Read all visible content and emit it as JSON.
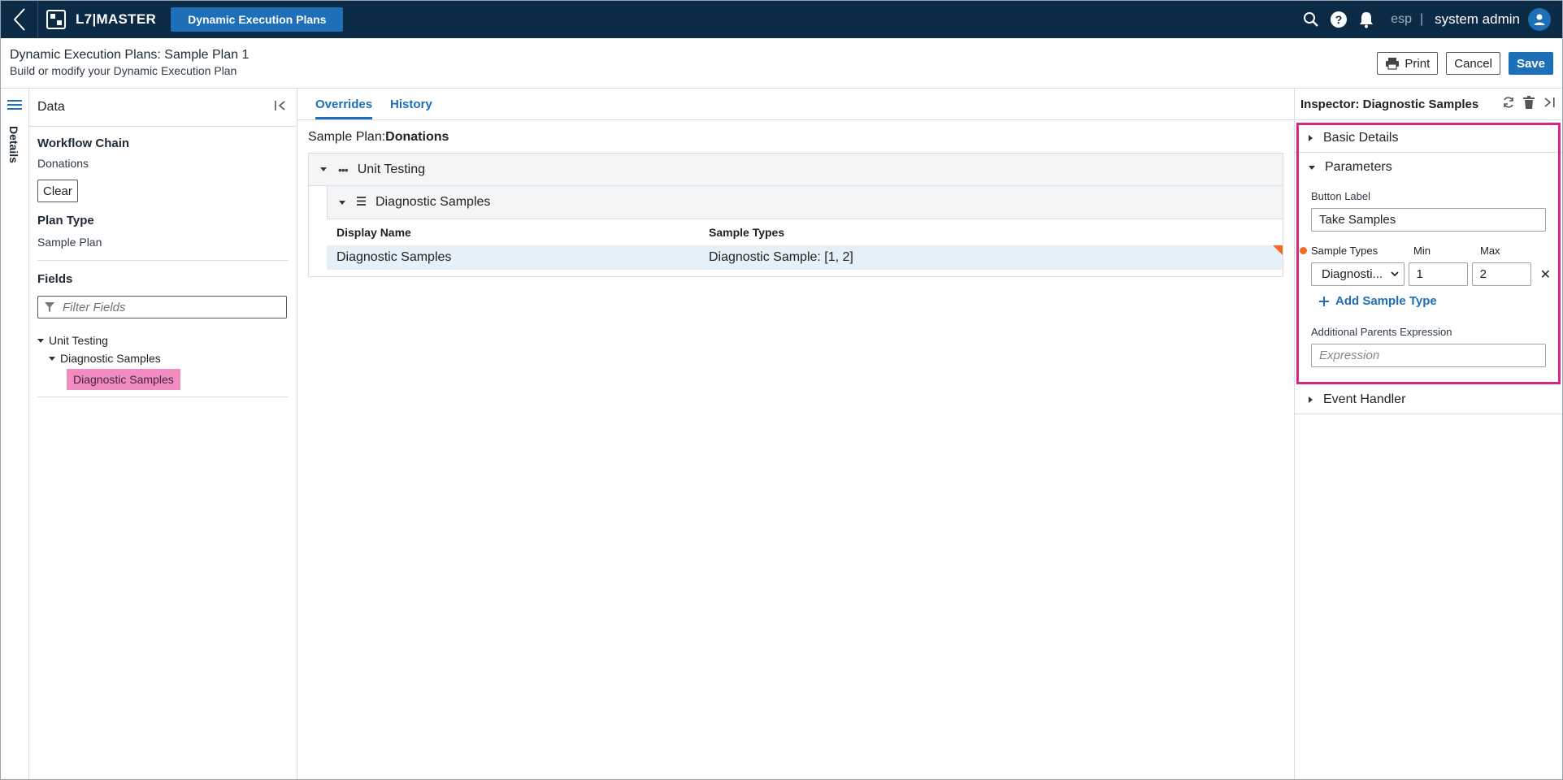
{
  "topbar": {
    "logo_text": "L7|MASTER",
    "app_name": "Dynamic Execution Plans",
    "lang": "esp",
    "separator": "|",
    "user": "system admin"
  },
  "page": {
    "title": "Dynamic Execution Plans: Sample Plan 1",
    "subtitle": "Build or modify your Dynamic Execution Plan",
    "print_label": "Print",
    "cancel_label": "Cancel",
    "save_label": "Save"
  },
  "rail": {
    "label": "Details"
  },
  "data_panel": {
    "title": "Data",
    "workflow_chain_label": "Workflow Chain",
    "workflow_chain_value": "Donations",
    "clear_label": "Clear",
    "plan_type_label": "Plan Type",
    "plan_type_value": "Sample Plan",
    "fields_label": "Fields",
    "filter_placeholder": "Filter Fields",
    "tree": {
      "root": "Unit Testing",
      "child": "Diagnostic Samples",
      "leaf": "Diagnostic Samples"
    }
  },
  "center": {
    "tabs": [
      "Overrides",
      "History"
    ],
    "plan_prefix": "Sample Plan:",
    "plan_name": "Donations",
    "group_unit": "Unit Testing",
    "group_diag": "Diagnostic Samples",
    "columns": [
      "Display Name",
      "Sample Types"
    ],
    "rows": [
      {
        "display_name": "Diagnostic Samples",
        "sample_types": "Diagnostic Sample: [1, 2]"
      }
    ]
  },
  "inspector": {
    "title": "Inspector: Diagnostic Samples",
    "basic_details": "Basic Details",
    "parameters": "Parameters",
    "button_label_label": "Button Label",
    "button_label_value": "Take Samples",
    "sample_types_label": "Sample Types",
    "min_label": "Min",
    "max_label": "Max",
    "sample_type_value": "Diagnosti...",
    "min_value": "1",
    "max_value": "2",
    "add_sample_type": "Add Sample Type",
    "additional_parents_label": "Additional Parents Expression",
    "expression_placeholder": "Expression",
    "event_handler": "Event Handler",
    "close_symbol": "✕"
  },
  "colors": {
    "topbar_bg": "#0b2a45",
    "accent": "#1d6fb8",
    "highlight_pink": "#f08cc0",
    "inspector_border": "#d6267f",
    "flag_orange": "#f26b21"
  }
}
